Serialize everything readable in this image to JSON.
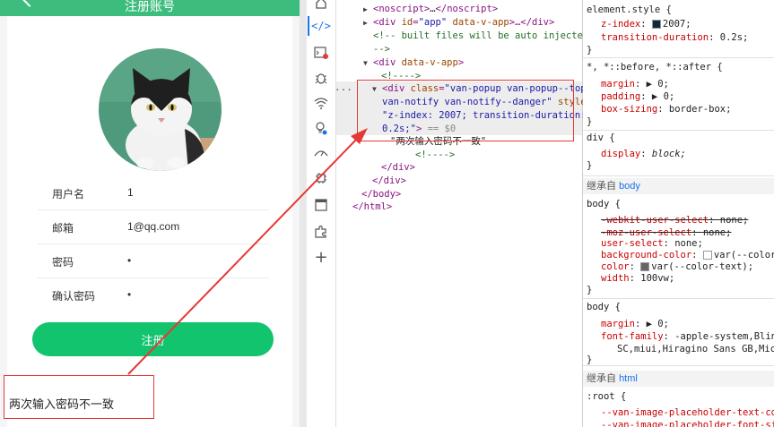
{
  "app": {
    "nav_title": "注册账号",
    "fields": [
      {
        "label": "用户名",
        "value": "1"
      },
      {
        "label": "邮箱",
        "value": "1@qq.com"
      },
      {
        "label": "密码",
        "value": "•"
      },
      {
        "label": "确认密码",
        "value": "•"
      }
    ],
    "register_label": "注册",
    "notify_text": "两次输入密码不一致"
  },
  "elements": {
    "lines": [
      {
        "text1": "<noscript>",
        "text2": "…",
        "text3": "</noscript>"
      },
      {
        "text1": "<div ",
        "attr": "id",
        "aval": "\"app\"",
        "attr2": " data-v-app",
        "text3": ">…</div>"
      },
      {
        "comment": "<!-- built files will be auto injected"
      },
      {
        "comment": "-->"
      },
      {
        "text1": "<div ",
        "attr": "data-v-app",
        "text3": ">"
      },
      {
        "comment": "<!---->"
      },
      {
        "sel1": "<div ",
        "sel_attr": "class",
        "sel_aval": "\"van-popup van-popup--top"
      },
      {
        "sel_aval2": "van-notify van-notify--danger\"",
        "sel_attr2": " style="
      },
      {
        "sel_aval3": "\"z-index: 2007; transition-duration:"
      },
      {
        "sel_aval4": "0.2s;\"",
        "sel_end": ">",
        "sel_eq": " == $0"
      },
      {
        "text": "\"两次输入密码不一致\""
      },
      {
        "comment": "<!---->"
      },
      {
        "close": "</div>"
      },
      {
        "close": "</div>"
      },
      {
        "close": "</body>"
      },
      {
        "close": "</html>"
      }
    ]
  },
  "styles": {
    "element_style": {
      "selector": "element.style {",
      "props": [
        {
          "name": "z-index",
          "value": "2007;"
        },
        {
          "name": "transition-duration",
          "value": "0.2s;"
        }
      ]
    },
    "universal": {
      "selector": "*, *::before, *::after {",
      "props": [
        {
          "name": "margin",
          "value": "▶ 0;"
        },
        {
          "name": "padding",
          "value": "▶ 0;"
        },
        {
          "name": "box-sizing",
          "value": "border-box;"
        }
      ]
    },
    "div_rule": {
      "selector": "div {",
      "props": [
        {
          "name": "display",
          "value": "block;"
        }
      ]
    },
    "inherited_body_label": "继承自",
    "inherited_body_link": "body",
    "body_rule": {
      "selector": "body {",
      "props": [
        {
          "name": "-webkit-user-select",
          "value": "none;"
        },
        {
          "name": "-moz-user-select",
          "value": "none;"
        },
        {
          "name": "user-select",
          "value": "none;"
        },
        {
          "name": "background-color",
          "value": "var(--color-b"
        },
        {
          "name": "color",
          "value": "var(--color-text);"
        },
        {
          "name": "width",
          "value": "100vw;"
        }
      ]
    },
    "body_rule2": {
      "selector": "body {",
      "props": [
        {
          "name": "margin",
          "value": "▶ 0;"
        },
        {
          "name": "font-family",
          "value": "-apple-system,BlinkM"
        },
        {
          "name": "",
          "value": "SC,miui,Hiragino Sans GB,Micro"
        }
      ]
    },
    "inherited_html_label": "继承自",
    "inherited_html_link": "html",
    "root_rule": {
      "selector": ":root {",
      "props": [
        {
          "name": "--van-image-placeholder-text-colo",
          "value": ""
        },
        {
          "name": "--van-image-placeholder-font-siz",
          "value": ""
        }
      ]
    },
    "colors": {
      "swatch_dark": "#0d2b3e",
      "swatch_white": "#ffffff",
      "swatch_gray": "#666666"
    }
  },
  "toolbar_icons": [
    "home-icon",
    "code-icon",
    "console-icon",
    "bug-icon",
    "wifi-icon",
    "lightbulb-icon",
    "performance-icon",
    "memory-icon",
    "application-icon",
    "extensions-icon",
    "plus-icon"
  ]
}
